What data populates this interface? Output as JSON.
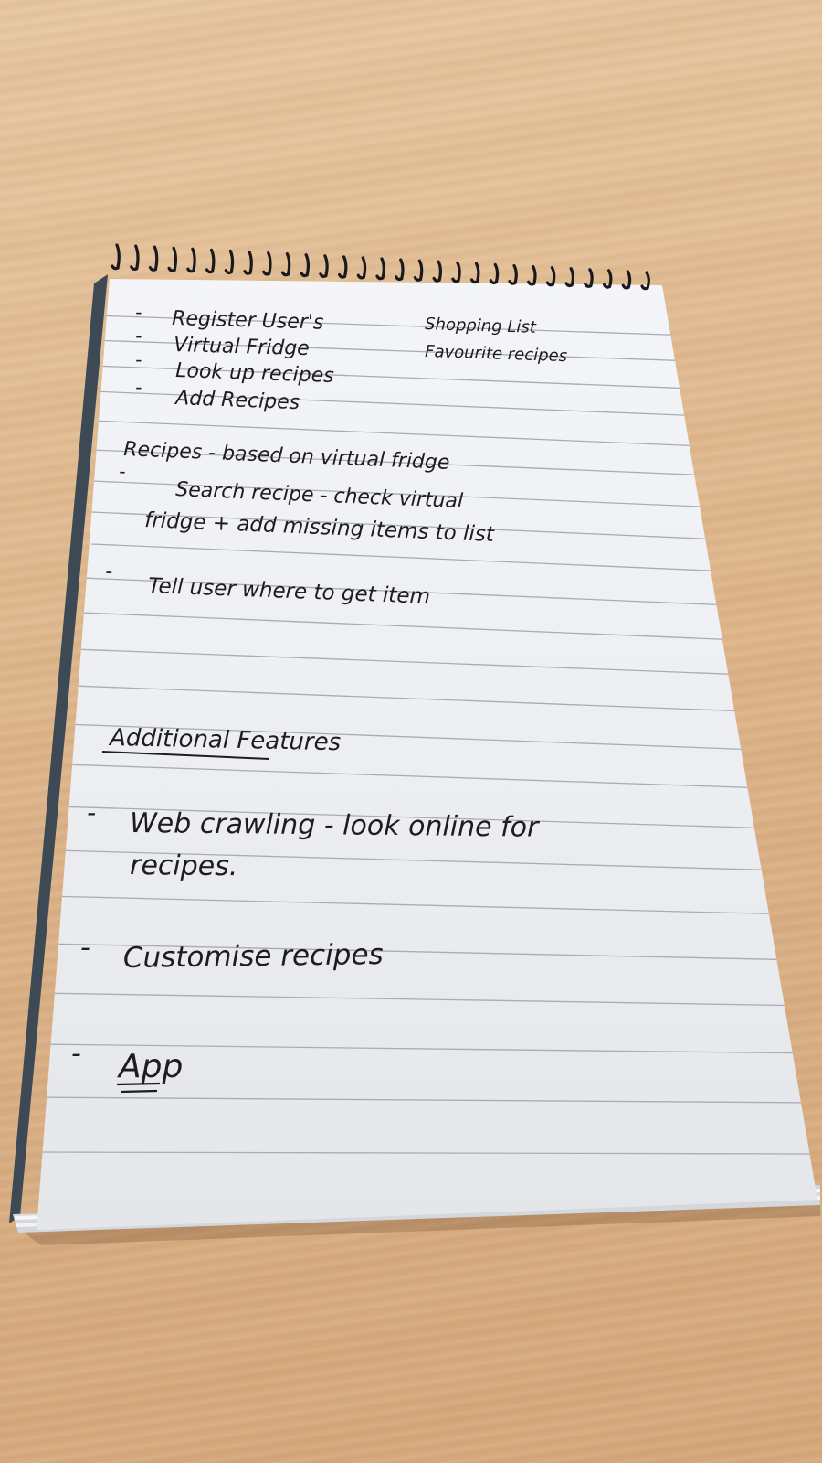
{
  "notepad": {
    "lines": {
      "register_users": "Register User's",
      "shopping_list": "Shopping List",
      "virtual_fridge": "Virtual Fridge",
      "favourite_recipes": "Favourite recipes",
      "look_up_recipes": "Look up recipes",
      "add_recipes": "Add Recipes",
      "recipes_based": "Recipes - based on virtual fridge",
      "search_recipe": "Search recipe - check virtual",
      "fridge_add_missing": "fridge + add missing items to list",
      "tell_user": "Tell user where to get item",
      "heading": "Additional Features",
      "web_crawling": "Web crawling - look online for",
      "recipes_period": "recipes.",
      "customise": "Customise recipes",
      "app": "App"
    },
    "dash": "-"
  }
}
